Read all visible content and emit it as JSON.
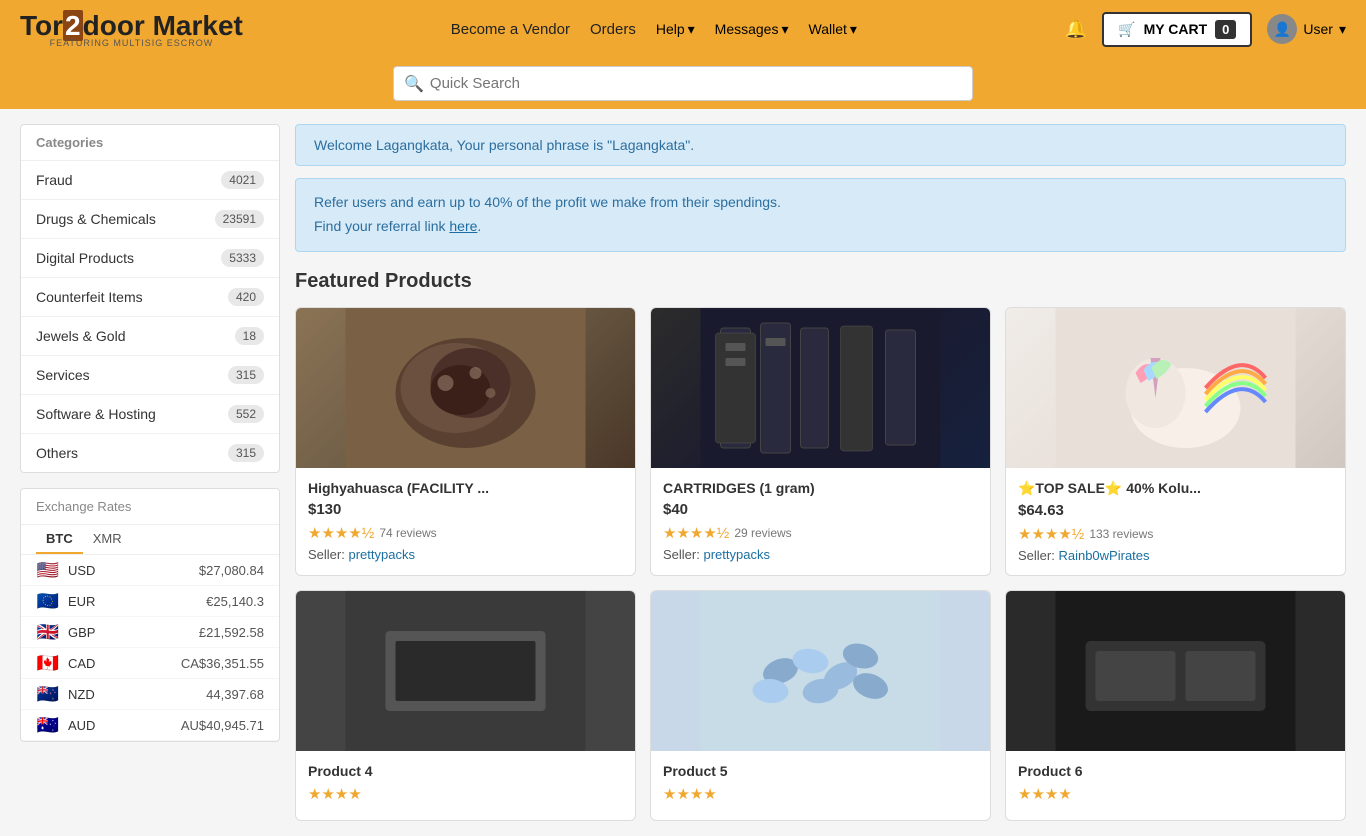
{
  "header": {
    "logo": "Tor2door Market",
    "logo_sub": "FEATURING MULTISIG ESCROW",
    "nav": [
      {
        "label": "Become a Vendor",
        "id": "become-vendor"
      },
      {
        "label": "Orders",
        "id": "orders"
      },
      {
        "label": "Help",
        "id": "help",
        "dropdown": true
      },
      {
        "label": "Messages",
        "id": "messages",
        "dropdown": true
      },
      {
        "label": "Wallet",
        "id": "wallet",
        "dropdown": true
      }
    ],
    "cart_label": "MY CART",
    "cart_count": "0",
    "user_label": "User"
  },
  "search": {
    "placeholder": "Quick Search"
  },
  "sidebar": {
    "categories_header": "Categories",
    "categories": [
      {
        "name": "Fraud",
        "count": "4021"
      },
      {
        "name": "Drugs & Chemicals",
        "count": "23591"
      },
      {
        "name": "Digital Products",
        "count": "5333"
      },
      {
        "name": "Counterfeit Items",
        "count": "420"
      },
      {
        "name": "Jewels & Gold",
        "count": "18"
      },
      {
        "name": "Services",
        "count": "315"
      },
      {
        "name": "Software & Hosting",
        "count": "552"
      },
      {
        "name": "Others",
        "count": "315"
      }
    ],
    "exchange_header": "Exchange Rates",
    "exchange_tabs": [
      "BTC",
      "XMR"
    ],
    "exchange_active_tab": "BTC",
    "exchange_rates": [
      {
        "flag": "🇺🇸",
        "code": "USD",
        "value": "$27,080.84"
      },
      {
        "flag": "🇪🇺",
        "code": "EUR",
        "value": "€25,140.3"
      },
      {
        "flag": "🇬🇧",
        "code": "GBP",
        "value": "£21,592.58"
      },
      {
        "flag": "🇨🇦",
        "code": "CAD",
        "value": "CA$36,351.55"
      },
      {
        "flag": "🇳🇿",
        "code": "NZD",
        "value": "44,397.68"
      },
      {
        "flag": "🇦🇺",
        "code": "AUD",
        "value": "AU$40,945.71"
      }
    ]
  },
  "main": {
    "welcome_message": "Welcome Lagangkata, Your personal phrase is \"Lagangkata\".",
    "referral_line1": "Refer users and earn up to 40% of the profit we make from their spendings.",
    "referral_line2": "Find your referral link here.",
    "referral_link_text": "here",
    "featured_title": "Featured Products",
    "products": [
      {
        "id": 1,
        "title": "Highyahuasca (FACILITY ...",
        "price": "$130",
        "rating": "4.5",
        "reviews": "74 reviews",
        "seller": "prettypacks",
        "img_type": "drug-rock"
      },
      {
        "id": 2,
        "title": "CARTRIDGES (1 gram)",
        "price": "$40",
        "rating": "4.5",
        "reviews": "29 reviews",
        "seller": "prettypacks",
        "img_type": "cartridges"
      },
      {
        "id": 3,
        "title": "⭐TOP SALE⭐ 40% Kolu...",
        "price": "$64.63",
        "rating": "4.5",
        "reviews": "133 reviews",
        "seller": "Rainb0wPirates",
        "img_type": "unicorn"
      },
      {
        "id": 4,
        "title": "Product 4",
        "price": "",
        "rating": "4.0",
        "reviews": "",
        "seller": "",
        "img_type": "dark"
      },
      {
        "id": 5,
        "title": "Product 5",
        "price": "",
        "rating": "4.0",
        "reviews": "",
        "seller": "",
        "img_type": "pills"
      },
      {
        "id": 6,
        "title": "Product 6",
        "price": "",
        "rating": "4.0",
        "reviews": "",
        "seller": "",
        "img_type": "dark2"
      }
    ]
  }
}
